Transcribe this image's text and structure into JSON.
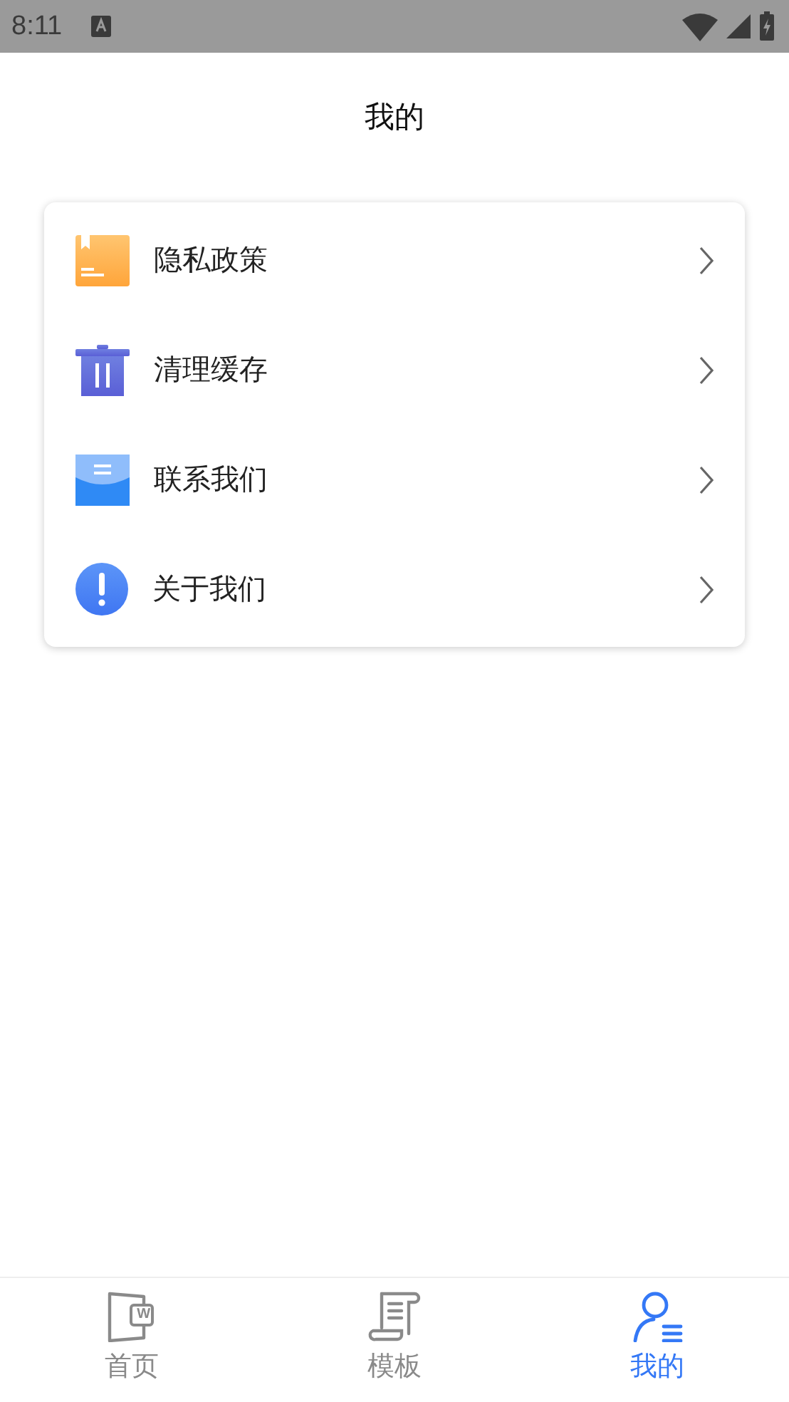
{
  "status_bar": {
    "time": "8:11"
  },
  "title": "我的",
  "menu": [
    {
      "kind": "policy",
      "label": "隐私政策"
    },
    {
      "kind": "trash",
      "label": "清理缓存"
    },
    {
      "kind": "mail",
      "label": "联系我们"
    },
    {
      "kind": "info",
      "label": "关于我们"
    }
  ],
  "tabs": [
    {
      "kind": "home",
      "label": "首页",
      "badge": "W",
      "selected": false
    },
    {
      "kind": "template",
      "label": "模板",
      "selected": false
    },
    {
      "kind": "mine",
      "label": "我的",
      "selected": true
    }
  ]
}
